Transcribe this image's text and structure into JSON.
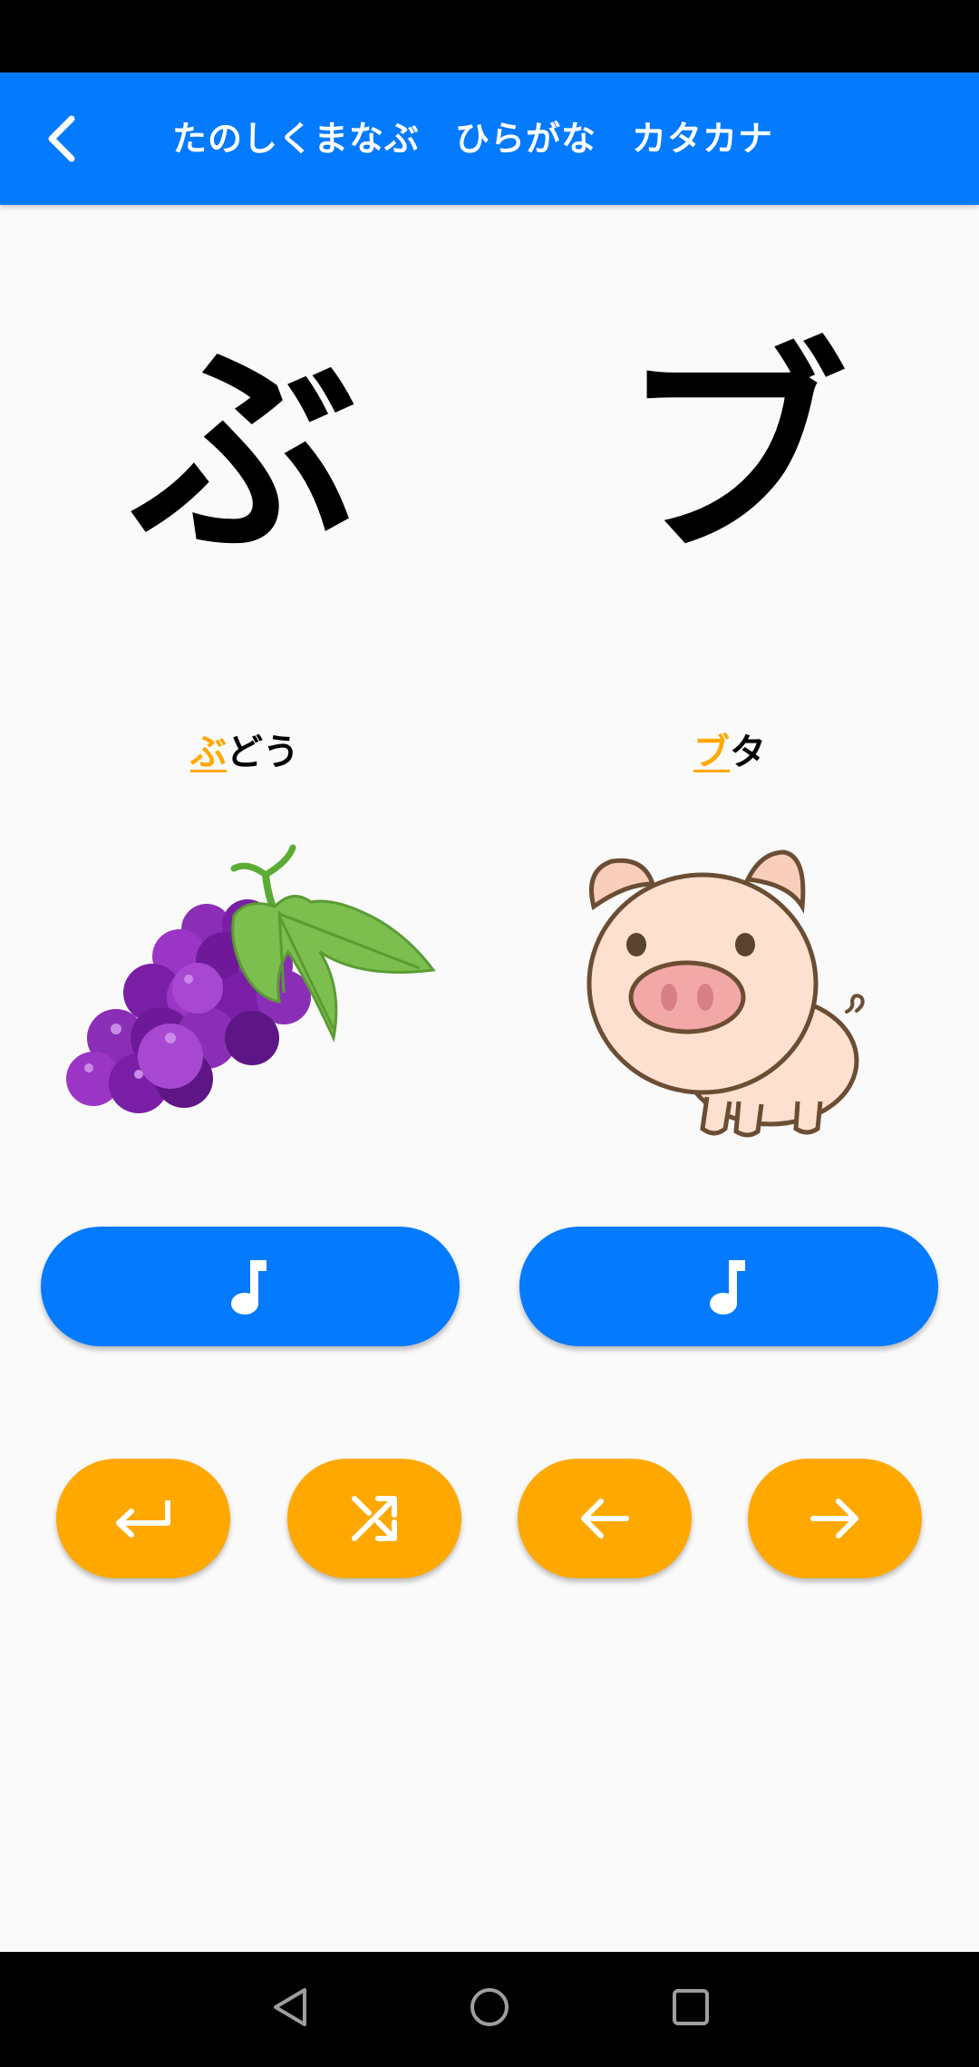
{
  "app_bar": {
    "title": "たのしくまなぶ　ひらがな　カタカナ",
    "back_icon": "chevron-left-icon"
  },
  "card": {
    "hiragana": "ぶ",
    "katakana": "ブ",
    "hiragana_word": {
      "highlight": "ぶ",
      "rest": "どう"
    },
    "katakana_word": {
      "highlight": "ブ",
      "rest": "タ"
    },
    "left_picture": "grapes",
    "right_picture": "pig"
  },
  "buttons": {
    "sound_icon": "music-note-icon",
    "controls": [
      "return-icon",
      "shuffle-icon",
      "arrow-left-icon",
      "arrow-right-icon"
    ]
  },
  "colors": {
    "primary": "#047afe",
    "accent": "#ffa800",
    "background": "#fafafa"
  }
}
